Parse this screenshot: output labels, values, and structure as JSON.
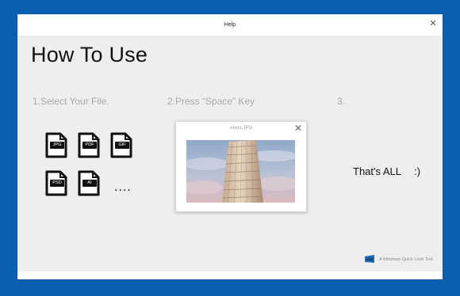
{
  "window": {
    "title": "Help"
  },
  "main": {
    "heading": "How To Use",
    "steps": [
      {
        "label": "1.Select Your File."
      },
      {
        "label": "2.Press “Space” Key"
      },
      {
        "label": "3."
      }
    ],
    "file_types": [
      "JPG",
      "PDF",
      "GIF",
      "PSD",
      "AI"
    ],
    "more": "....",
    "preview": {
      "filename": "xxxxx.JPG"
    },
    "done_text": "That's ALL 　:)"
  },
  "footer": {
    "text": "A Windows Quick Look Tool"
  },
  "colors": {
    "desktop": "#0a5fb0",
    "window": "#eeeeee",
    "step_text": "#a9a9a9"
  }
}
